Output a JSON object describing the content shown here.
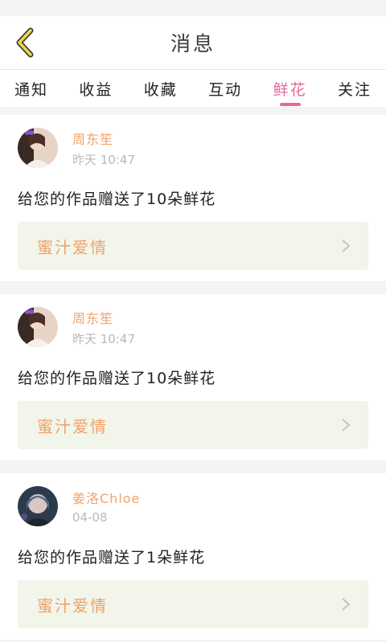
{
  "header": {
    "title": "消息"
  },
  "tabs": [
    {
      "label": "通知",
      "active": false
    },
    {
      "label": "收益",
      "active": false
    },
    {
      "label": "收藏",
      "active": false
    },
    {
      "label": "互动",
      "active": false
    },
    {
      "label": "鲜花",
      "active": true
    },
    {
      "label": "关注",
      "active": false
    }
  ],
  "messages": [
    {
      "username": "周东笙",
      "time": "昨天 10:47",
      "text": "给您的作品赠送了10朵鲜花",
      "work_title": "蜜汁爱情",
      "avatar": "profile-photo"
    },
    {
      "username": "周东笙",
      "time": "昨天 10:47",
      "text": "给您的作品赠送了10朵鲜花",
      "work_title": "蜜汁爱情",
      "avatar": "profile-photo"
    },
    {
      "username": "姜洛Chloe",
      "time": "04-08",
      "text": "给您的作品赠送了1朵鲜花",
      "work_title": "蜜汁爱情",
      "avatar": "profile-photo"
    }
  ],
  "colors": {
    "accent": "#e36a9a",
    "username": "#f0a26a",
    "work_bg": "#f2f5ea",
    "back_arrow": "#f1d64a"
  }
}
